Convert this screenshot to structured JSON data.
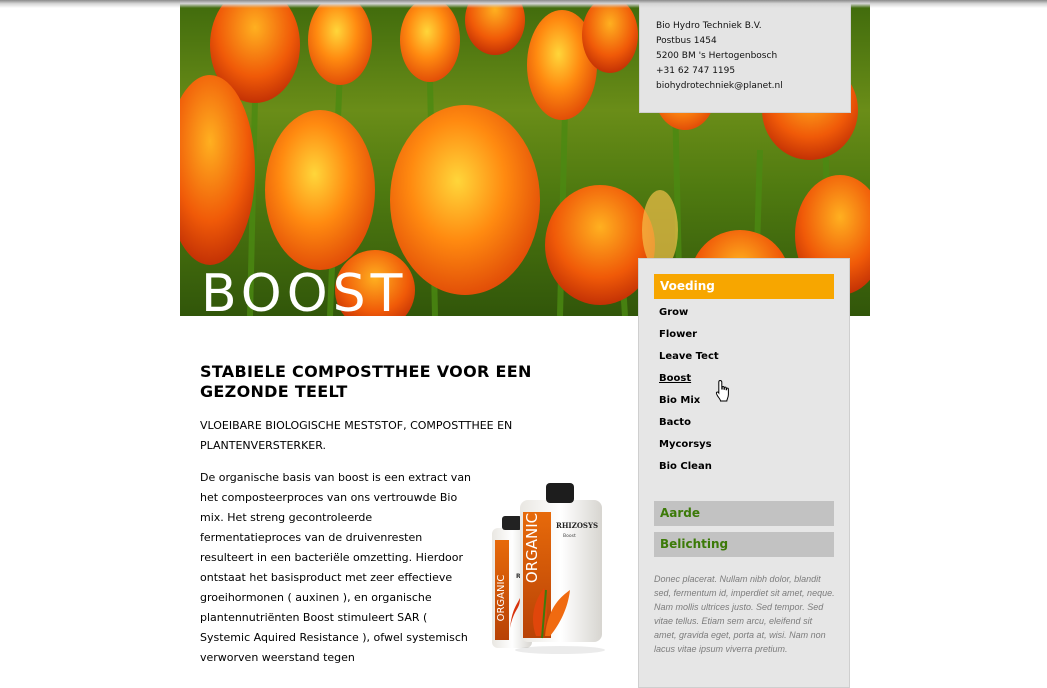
{
  "hero": {
    "title": "BOOST"
  },
  "contact": {
    "lines": [
      "Bio Hydro Techniek B.V.",
      "Postbus 1454",
      "5200 BM 's Hertogenbosch",
      "+31 62 747 1195",
      "biohydrotechniek@planet.nl"
    ]
  },
  "sidebar": {
    "active_category": "Voeding",
    "items": [
      "Grow",
      "Flower",
      "Leave Tect",
      "Boost",
      "Bio Mix",
      "Bacto",
      "Mycorsys",
      "Bio Clean"
    ],
    "current_item": "Boost",
    "categories": [
      "Aarde",
      "Belichting"
    ],
    "note": "Donec placerat. Nullam nibh dolor, blandit sed, fermentum id, imperdiet sit amet, neque. Nam mollis ultrices justo. Sed tempor. Sed vitae tellus. Etiam sem arcu, eleifend sit amet, gravida eget, porta at, wisi. Nam non lacus vitae ipsum viverra pretium."
  },
  "main": {
    "headline": "STABIELE COMPOSTTHEE VOOR EEN GEZONDE TEELT",
    "subhead": "VLOEIBARE BIOLOGISCHE MESTSTOF, COMPOSTTHEE EN PLANTENVERSTERKER.",
    "body": "De organische basis van boost is een extract van het composteerproces van ons vertrouwde Bio mix. Het streng gecontroleerde fermentatieproces van de druivenresten resulteert in een bacteriële omzetting. Hierdoor ontstaat het basisproduct met zeer effectieve groeihormonen ( auxinen ), en organische plantennutriënten Boost stimuleert SAR ( Systemic Aquired Resistance ), ofwel systemisch  verworven weerstand tegen"
  },
  "product": {
    "band_text": "ORGANIC",
    "brand": "RHIZOSYS",
    "variant": "Boost",
    "back_label": "RI"
  },
  "colors": {
    "accent_orange": "#f7a600",
    "category_green": "#3c7a08",
    "sidebar_bg": "#e6e6e6",
    "category_grey": "#c2c2c2"
  },
  "icons": {
    "cursor": "hand-pointer-icon"
  }
}
